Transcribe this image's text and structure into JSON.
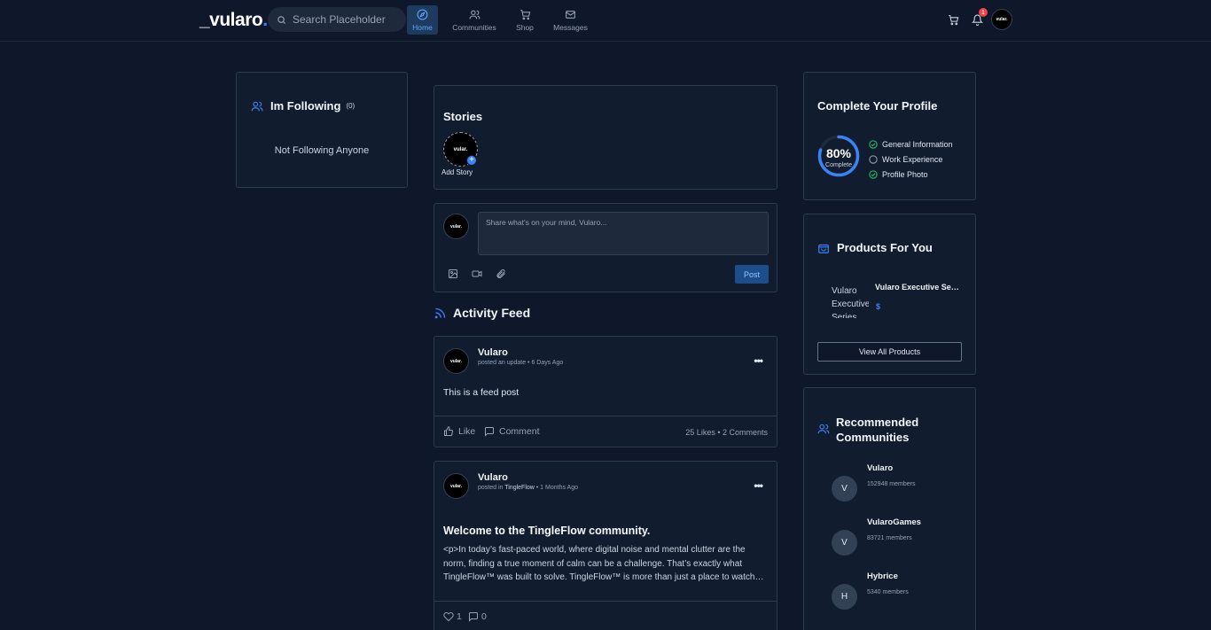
{
  "brand": {
    "logo_text": "_vularo",
    "logo_dot": "."
  },
  "search": {
    "placeholder": "Search Placeholder"
  },
  "nav": {
    "home": "Home",
    "communities": "Communities",
    "shop": "Shop",
    "messages": "Messages",
    "notification_count": "1",
    "user_avatar_text": "vular."
  },
  "following": {
    "title": "Im Following",
    "count": "(0)",
    "empty_text": "Not Following Anyone"
  },
  "stories": {
    "title": "Stories",
    "avatar_text": "vular.",
    "add_label": "Add Story"
  },
  "composer": {
    "placeholder": "Share what's on your mind, Vularo...",
    "post_label": "Post",
    "avatar_text": "vular."
  },
  "feed": {
    "title": "Activity Feed",
    "posts": [
      {
        "author": "Vularo",
        "meta": "posted an update • 6 Days Ago",
        "body": "This is a feed post",
        "like_label": "Like",
        "comment_label": "Comment",
        "stats": "25 Likes • 2 Comments",
        "avatar_text": "vular."
      },
      {
        "author": "Vularo",
        "meta_prefix": "posted in ",
        "meta_group": "TingleFlow",
        "meta_suffix": " • 1 Months Ago",
        "title": "Welcome to the TingleFlow community.",
        "excerpt": "<p>In today’s fast-paced world, where digital noise and mental clutter are the norm, finding a true moment of calm can be a challenge. That’s exactly what TingleFlow™ was built to solve. TingleFlow™ is more than just a place to watch…",
        "likes": "1",
        "comments": "0",
        "avatar_text": "vular."
      }
    ]
  },
  "profile": {
    "title": "Complete Your Profile",
    "percent": 80,
    "percent_label": "80%",
    "complete_label": "Complete",
    "items": [
      {
        "label": "General Information",
        "done": true
      },
      {
        "label": "Work Experience",
        "done": false
      },
      {
        "label": "Profile Photo",
        "done": true
      }
    ]
  },
  "products": {
    "title": "Products For You",
    "item_alt": "Vularo Executive Series",
    "item_name": "Vularo Executive Seri...",
    "item_price": "$",
    "view_all": "View All Products"
  },
  "communities": {
    "title": "Recommended Communities",
    "items": [
      {
        "initial": "V",
        "name": "Vularo",
        "members": "152948 members"
      },
      {
        "initial": "V",
        "name": "VularoGames",
        "members": "83721 members"
      },
      {
        "initial": "H",
        "name": "Hybrice",
        "members": "5340 members"
      }
    ]
  },
  "colors": {
    "accent": "#3b82f6",
    "background": "#0f172a",
    "card": "#111c2f",
    "success": "#22c55e",
    "danger": "#ef4444"
  }
}
